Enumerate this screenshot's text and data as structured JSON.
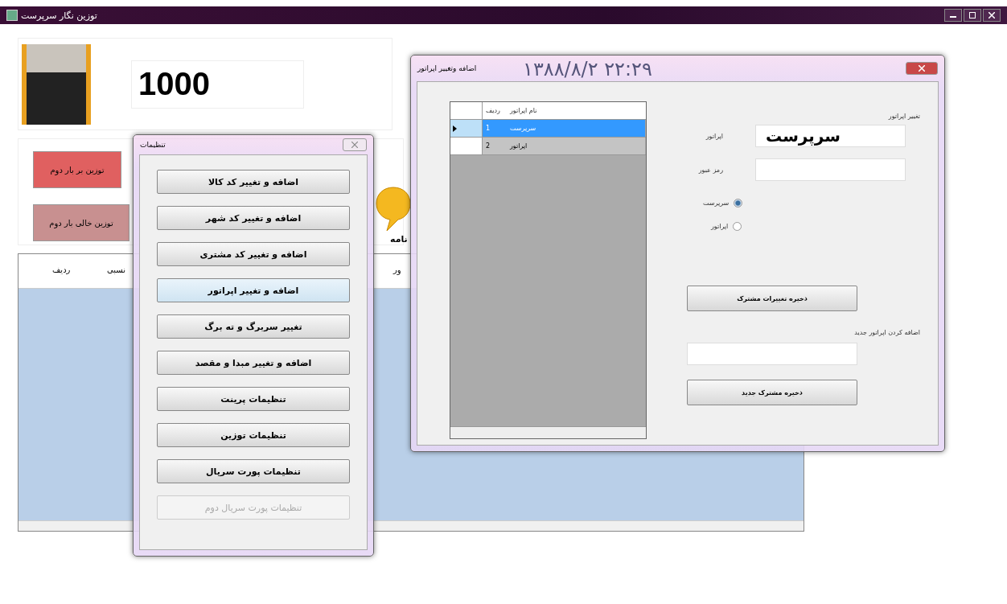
{
  "window": {
    "title": "توزین نگار سرپرست"
  },
  "weight": {
    "value": "1000"
  },
  "date_time": "۱۳۸۸/۸/۲   ۲۲:۲۹",
  "actions": [
    {
      "label": "توزین بر بار دوم",
      "kind": "primary"
    },
    {
      "label": "توزین خالی بار دوم",
      "kind": "secondary"
    }
  ],
  "message_button": {
    "label": "نامه"
  },
  "main_grid": {
    "columns": [
      "ور",
      "نسبی",
      "ردیف"
    ]
  },
  "settings_dialog": {
    "title": "تنظیمات",
    "buttons": [
      {
        "label": "اضافه و تغییر کد کالا",
        "focused": false,
        "disabled": false
      },
      {
        "label": "اضافه و تغییر کد شهر",
        "focused": false,
        "disabled": false
      },
      {
        "label": "اضافه و تغییر کد مشتری",
        "focused": false,
        "disabled": false
      },
      {
        "label": "اضافه و تغییر  اپراتور",
        "focused": true,
        "disabled": false
      },
      {
        "label": "تغییر سربرگ و ته برگ",
        "focused": false,
        "disabled": false
      },
      {
        "label": "اضافه و تغییر مبدا و مقصد",
        "focused": false,
        "disabled": false
      },
      {
        "label": "تنظیمات پرینت",
        "focused": false,
        "disabled": false
      },
      {
        "label": "تنظیمات توزین",
        "focused": false,
        "disabled": false
      },
      {
        "label": "تنظیمات پورت سریال",
        "focused": false,
        "disabled": false
      },
      {
        "label": "تنظیمات پورت سریال دوم",
        "focused": false,
        "disabled": true
      }
    ]
  },
  "operator_dialog": {
    "title": "اضافه وتغییر اپراتور",
    "grid": {
      "columns": [
        "نام اپراتور",
        "ردیف"
      ],
      "rows": [
        {
          "cells": [
            "سرپرست",
            "1"
          ],
          "selected": true
        },
        {
          "cells": [
            "اپراتور",
            "2"
          ],
          "selected": false
        }
      ]
    },
    "group_label": "تغییر اپراتور",
    "operator_label": "اپراتور",
    "operator_value": "سرپرست",
    "password_label": "رمز عبور",
    "roles": [
      {
        "label": "سرپرست",
        "selected": true
      },
      {
        "label": "اپراتور",
        "selected": false
      }
    ],
    "save_changes": "ذخیره تغییرات  مشترک",
    "new_label": "اضافه کردن اپراتور جدید",
    "save_new": "ذخیره مشترک جدید"
  }
}
